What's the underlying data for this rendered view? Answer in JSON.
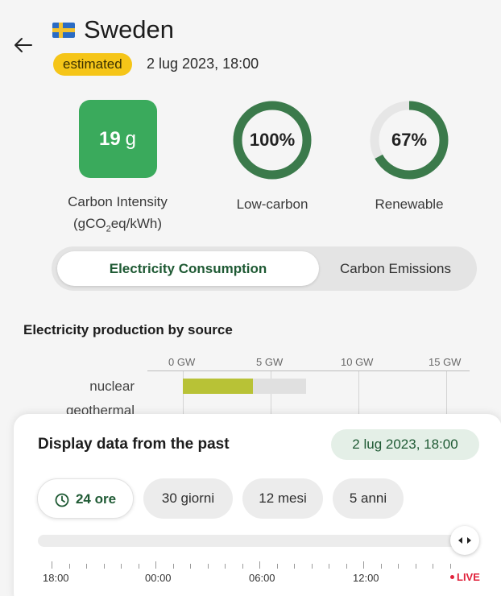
{
  "header": {
    "country": "Sweden",
    "badge": "estimated",
    "datetime": "2 lug 2023, 18:00"
  },
  "metrics": {
    "carbon_intensity": {
      "value": "19",
      "unit": "g",
      "label_line1": "Carbon Intensity",
      "label_line2_prefix": "(gCO",
      "label_line2_sub": "2",
      "label_line2_suffix": "eq/kWh)"
    },
    "low_carbon": {
      "percent": 100,
      "display": "100%",
      "label": "Low-carbon"
    },
    "renewable": {
      "percent": 67,
      "display": "67%",
      "label": "Renewable"
    }
  },
  "toggle": {
    "active": "Electricity Consumption",
    "inactive": "Carbon Emissions"
  },
  "chart_data": {
    "type": "bar",
    "title": "Electricity production by source",
    "x_ticks": [
      "0 GW",
      "5 GW",
      "10 GW",
      "15 GW"
    ],
    "xlim": [
      0,
      16
    ],
    "categories": [
      "nuclear",
      "geothermal"
    ],
    "values": [
      4.0,
      null
    ],
    "capacity": [
      7.0,
      null
    ]
  },
  "past_panel": {
    "title": "Display data from the past",
    "date": "2 lug 2023, 18:00",
    "ranges": [
      "24 ore",
      "30 giorni",
      "12 mesi",
      "5 anni"
    ],
    "selected_range": "24 ore",
    "time_labels": [
      "18:00",
      "00:00",
      "06:00",
      "12:00"
    ],
    "live_label": "LIVE"
  },
  "colors": {
    "accent_green": "#1f5a34",
    "ci_box": "#3aaa5c",
    "ring": "#3b7a4b",
    "badge": "#f5c518",
    "bar_fill": "#b8c236",
    "live": "#e0223b"
  }
}
